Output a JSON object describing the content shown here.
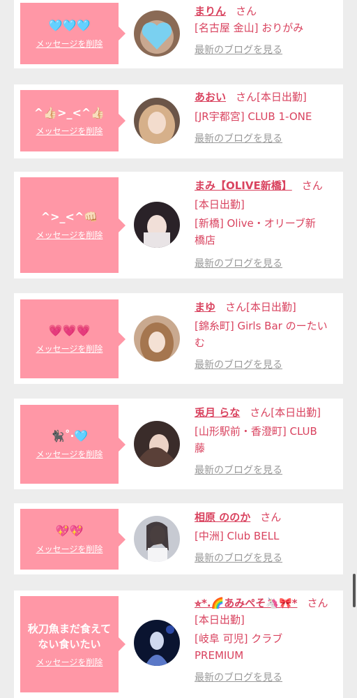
{
  "delete_label": "メッセージを削除",
  "blog_label": "最新のブログを見る",
  "san_label": "さん",
  "cards": [
    {
      "message": "🩵🩵🩵",
      "name": "まりん",
      "status": "",
      "location_line1": "[名古屋 金山] おりがみ",
      "location_line2": ""
    },
    {
      "message": "^👍🏻>_<^👍🏻",
      "name": "あおい",
      "status": "[本日出勤]",
      "location_line1": "[JR宇都宮] CLUB 1-ONE",
      "location_line2": ""
    },
    {
      "message": "^>_<^👊🏻",
      "name": "まみ【OLIVE新橋】",
      "status": "[本日出勤]",
      "location_line1": "[新橋] Olive・オリーブ新",
      "location_line2": "橋店"
    },
    {
      "message": "💗💗💗",
      "name": "まゆ",
      "status": "[本日出勤]",
      "location_line1": "[錦糸町] Girls Bar のーたい",
      "location_line2": "む"
    },
    {
      "message": "🐈‍⬛˚‧🩵",
      "name": "兎月 らな",
      "status": "[本日出勤]",
      "location_line1": "[山形駅前・香澄町] CLUB",
      "location_line2": "藤"
    },
    {
      "message": "💖💖",
      "name": "相原 ののか",
      "status": "",
      "location_line1": "[中洲] Club BELL",
      "location_line2": ""
    },
    {
      "message": "秋刀魚まだ食えてない食いたい",
      "name": "⭐︎*.🌈あみぺそ🦄🎀*",
      "status": "[本日出勤]",
      "location_line1": "[岐阜 可児] クラブ",
      "location_line2": "PREMIUM"
    }
  ]
}
